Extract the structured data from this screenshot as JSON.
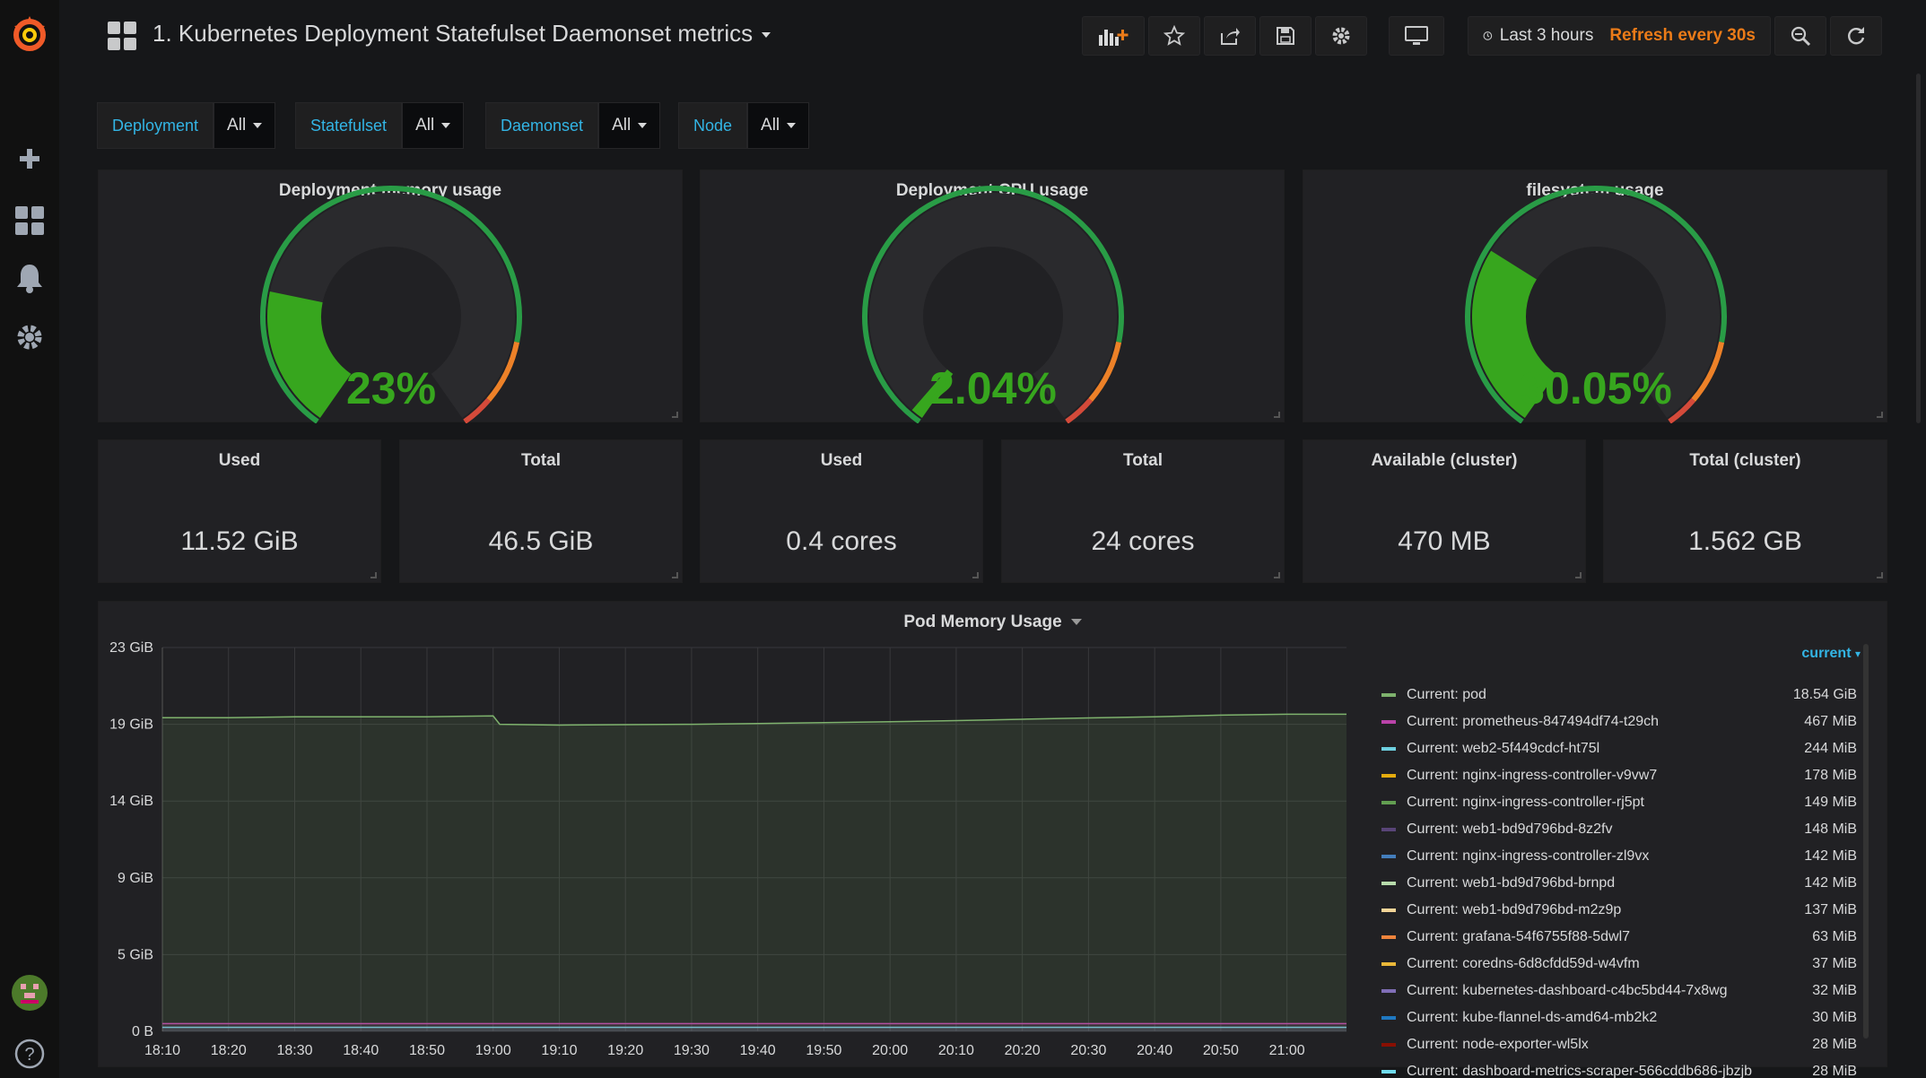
{
  "header": {
    "title": "1. Kubernetes Deployment Statefulset Daemonset metrics",
    "time_range": "Last 3 hours",
    "refresh": "Refresh every 30s"
  },
  "variables": [
    {
      "label": "Deployment",
      "value": "All"
    },
    {
      "label": "Statefulset",
      "value": "All"
    },
    {
      "label": "Daemonset",
      "value": "All"
    },
    {
      "label": "Node",
      "value": "All"
    }
  ],
  "gauges": [
    {
      "title": "Deployment memory usage",
      "display": "23%",
      "percent": 23
    },
    {
      "title": "Deployment CPU usage",
      "display": "2.04%",
      "percent": 2.04
    },
    {
      "title": "filesystem usage",
      "display": "30.05%",
      "percent": 30.05
    }
  ],
  "stats": [
    {
      "title": "Used",
      "value": "11.52 GiB"
    },
    {
      "title": "Total",
      "value": "46.5 GiB"
    },
    {
      "title": "Used",
      "value": "0.4 cores"
    },
    {
      "title": "Total",
      "value": "24 cores"
    },
    {
      "title": "Available (cluster)",
      "value": "470 MB"
    },
    {
      "title": "Total (cluster)",
      "value": "1.562 GB"
    }
  ],
  "graph": {
    "title": "Pod Memory Usage",
    "legend_header": "current",
    "legend": [
      {
        "name": "Current: pod",
        "value": "18.54 GiB",
        "color": "#7eb26d"
      },
      {
        "name": "Current: prometheus-847494df74-t29ch",
        "value": "467 MiB",
        "color": "#ba43a9"
      },
      {
        "name": "Current: web2-5f449cdcf-ht75l",
        "value": "244 MiB",
        "color": "#6ed0e0"
      },
      {
        "name": "Current: nginx-ingress-controller-v9vw7",
        "value": "178 MiB",
        "color": "#e5ac0e"
      },
      {
        "name": "Current: nginx-ingress-controller-rj5pt",
        "value": "149 MiB",
        "color": "#629e51"
      },
      {
        "name": "Current: web1-bd9d796bd-8z2fv",
        "value": "148 MiB",
        "color": "#584477"
      },
      {
        "name": "Current: nginx-ingress-controller-zl9vx",
        "value": "142 MiB",
        "color": "#447ebc"
      },
      {
        "name": "Current: web1-bd9d796bd-brnpd",
        "value": "142 MiB",
        "color": "#b7dbab"
      },
      {
        "name": "Current: web1-bd9d796bd-m2z9p",
        "value": "137 MiB",
        "color": "#f4d598"
      },
      {
        "name": "Current: grafana-54f6755f88-5dwl7",
        "value": "63 MiB",
        "color": "#ef843c"
      },
      {
        "name": "Current: coredns-6d8cfdd59d-w4vfm",
        "value": "37 MiB",
        "color": "#eab839"
      },
      {
        "name": "Current: kubernetes-dashboard-c4bc5bd44-7x8wg",
        "value": "32 MiB",
        "color": "#806eb7"
      },
      {
        "name": "Current: kube-flannel-ds-amd64-mb2k2",
        "value": "30 MiB",
        "color": "#1f78c1"
      },
      {
        "name": "Current: node-exporter-wl5lx",
        "value": "28 MiB",
        "color": "#890f02"
      },
      {
        "name": "Current: dashboard-metrics-scraper-566cddb686-jbzjb",
        "value": "28 MiB",
        "color": "#70dbed"
      }
    ]
  },
  "chart_data": {
    "type": "area",
    "title": "Pod Memory Usage",
    "xlabel": "",
    "ylabel": "",
    "x": [
      "18:10",
      "18:20",
      "18:30",
      "18:40",
      "18:50",
      "19:00",
      "19:10",
      "19:20",
      "19:30",
      "19:40",
      "19:50",
      "20:00",
      "20:10",
      "20:20",
      "20:30",
      "20:40",
      "20:50",
      "21:00"
    ],
    "y_ticks": [
      "0 B",
      "5 GiB",
      "9 GiB",
      "14 GiB",
      "19 GiB",
      "23 GiB"
    ],
    "ylim_gib": [
      0,
      23
    ],
    "series": [
      {
        "name": "Current: pod",
        "color": "#7eb26d",
        "points": [
          [
            0,
            18.8
          ],
          [
            1,
            18.8
          ],
          [
            2,
            18.85
          ],
          [
            3,
            18.85
          ],
          [
            4,
            18.85
          ],
          [
            5,
            18.9
          ],
          [
            5.1,
            18.4
          ],
          [
            6,
            18.35
          ],
          [
            7,
            18.38
          ],
          [
            8,
            18.4
          ],
          [
            9,
            18.45
          ],
          [
            10,
            18.5
          ],
          [
            11,
            18.55
          ],
          [
            12,
            18.62
          ],
          [
            13,
            18.7
          ],
          [
            14,
            18.78
          ],
          [
            15,
            18.85
          ],
          [
            16,
            18.95
          ],
          [
            17,
            19.0
          ],
          [
            17.9,
            19.0
          ]
        ]
      },
      {
        "name": "Current: prometheus-847494df74-t29ch",
        "color": "#ba43a9",
        "points": [
          [
            0,
            0.46
          ],
          [
            17.9,
            0.46
          ]
        ]
      },
      {
        "name": "Current: web2-5f449cdcf-ht75l",
        "color": "#6ed0e0",
        "points": [
          [
            0,
            0.24
          ],
          [
            17.9,
            0.24
          ]
        ]
      }
    ]
  }
}
